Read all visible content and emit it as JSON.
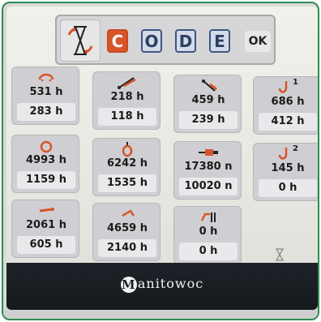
{
  "accent_color": "#d8542a",
  "topbar": {
    "mode_icon": "hourglass-reset-icon",
    "code_keys": [
      {
        "label": "C",
        "active": true
      },
      {
        "label": "O",
        "active": false
      },
      {
        "label": "D",
        "active": false
      },
      {
        "label": "E",
        "active": false
      }
    ],
    "ok_label": "OK"
  },
  "tiles": [
    {
      "icon": "hoist-rope-icon",
      "top": "531 h",
      "bottom": "283 h"
    },
    {
      "icon": "boom-telescope-icon",
      "top": "218 h",
      "bottom": "118 h"
    },
    {
      "icon": "boom-luff-icon",
      "top": "459 h",
      "bottom": "239 h"
    },
    {
      "icon": "main-hook-icon",
      "superscript": "1",
      "top": "686 h",
      "bottom": "412 h"
    },
    {
      "icon": "slew-ring-icon",
      "top": "4993 h",
      "bottom": "1159 h"
    },
    {
      "icon": "counterweight-hook-icon",
      "top": "6242 h",
      "bottom": "1535 h"
    },
    {
      "icon": "hydraulic-cylinder-icon",
      "top": "17380 n",
      "bottom": "10020 n"
    },
    {
      "icon": "auxiliary-hook-icon",
      "superscript": "2",
      "top": "145 h",
      "bottom": "0 h"
    },
    {
      "icon": "outrigger-icon",
      "top": "2061 h",
      "bottom": "605 h"
    },
    {
      "icon": "jib-icon",
      "top": "4659 h",
      "bottom": "2140 h"
    },
    {
      "icon": "swing-lock-icon",
      "top": "0 h",
      "bottom": "0 h"
    }
  ],
  "footer": {
    "logo_initial": "M",
    "logo_text": "anitowoc"
  }
}
